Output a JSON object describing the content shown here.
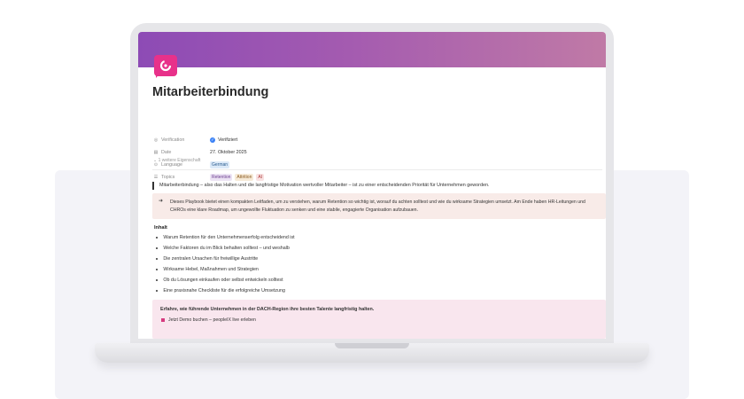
{
  "page": {
    "title": "Mitarbeiterbindung"
  },
  "properties": [
    {
      "key": "Verification",
      "icon": "verification-icon",
      "value": "Verifiziert"
    },
    {
      "key": "Date",
      "icon": "calendar-icon",
      "value": "27. Oktober 2025"
    },
    {
      "key": "Language",
      "icon": "language-icon",
      "value": "German"
    },
    {
      "key": "Topics",
      "icon": "list-icon",
      "tags": [
        "Retention",
        "Attrition",
        "AI"
      ]
    }
  ],
  "more_properties": "1 weitere Eigenschaft",
  "quote": "Mitarbeiterbindung – also das Halten und die langfristige Motivation wertvoller Mitarbeiter – ist zu einer entscheidenden Priorität für Unternehmen geworden.",
  "callout": {
    "icon": "arrow-right-icon",
    "text": "Dieses Playbook bietet einen kompakten Leitfaden, um zu verstehen, warum Retention so wichtig ist, worauf du achten solltest und wie du wirksame Strategien umsetzt. Am Ende haben HR-Leitungen und CHROs eine klare Roadmap, um ungewollte Fluktuation zu senken und eine stabile, engagierte Organisation aufzubauen."
  },
  "toc": {
    "heading": "Inhalt",
    "items": [
      "Warum Retention für den Unternehmenserfolg entscheidend ist",
      "Welche Faktoren du im Blick behalten solltest – und weshalb",
      "Die zentralen Ursachen für freiwillige Austritte",
      "Wirksame Hebel, Maßnahmen und Strategien",
      "Ob du Lösungen einkaufen oder selbst entwickeln solltest",
      "Eine praxisnahe Checkliste für die erfolgreiche Umsetzung"
    ]
  },
  "cta": {
    "text": "Erfahre, wie führende Unternehmen in der DACH-Region ihre besten Talente langfristig halten.",
    "link": "Jetzt Demo buchen – peopleIX live erleben"
  },
  "colors": {
    "cover_start": "#8d4bb5",
    "cover_end": "#c07aa6",
    "logo": "#e8318a",
    "verified": "#3b82f6"
  }
}
